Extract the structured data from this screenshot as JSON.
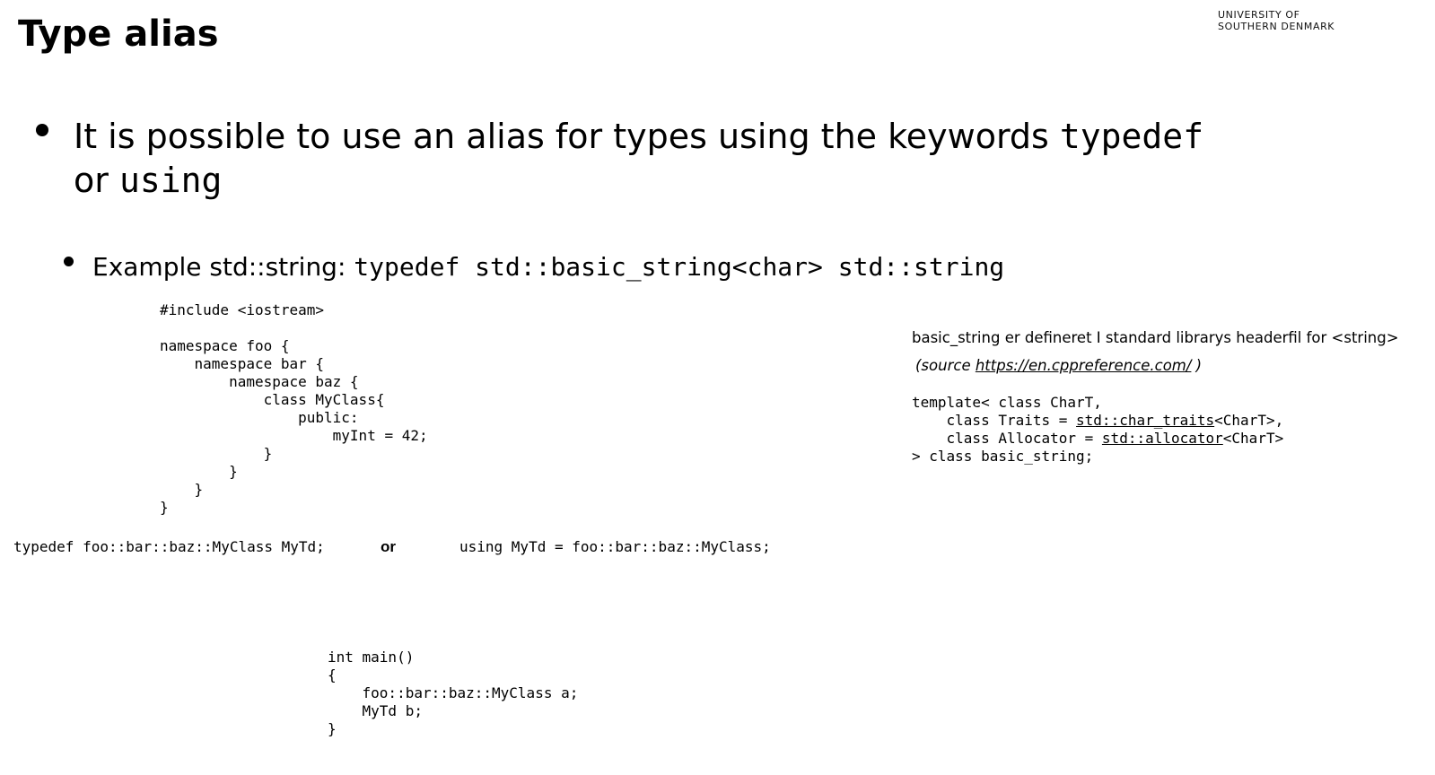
{
  "header": {
    "title": "Type alias",
    "logo_line1": "UNIVERSITY OF",
    "logo_line2": "SOUTHERN DENMARK"
  },
  "bullet1": {
    "text": "It is possible to use an alias for types using the keywords ",
    "kw_typedef": "typedef",
    "or_text": "or ",
    "kw_using": "using"
  },
  "bullet2": {
    "label": "Example std::string: ",
    "code": "typedef std::basic_string<char> std::string"
  },
  "namespace_code": "#include <iostream>\n\nnamespace foo {\n    namespace bar {\n        namespace baz {\n            class MyClass{\n                public:\n                    myInt = 42;\n            }\n        }\n    }\n}",
  "alias_line": {
    "typedef_code": "typedef foo::bar::baz::MyClass MyTd;",
    "or_label": "or",
    "using_code": "using MyTd = foo::bar::baz::MyClass;"
  },
  "main_code": "int main()\n{\n    foo::bar::baz::MyClass a;\n    MyTd b;\n}",
  "side_note": {
    "text": "basic_string er defineret I standard librarys headerfil for <string>",
    "source_prefix": "(source ",
    "source_link": "https://en.cppreference.com/",
    "source_suffix": " )",
    "template_line1": "template< class CharT,",
    "template_line2_prefix": "    class Traits = ",
    "template_line2_link": "std::char_traits",
    "template_line2_suffix": "<CharT>,",
    "template_line3_prefix": "    class Allocator = ",
    "template_line3_link": "std::allocator",
    "template_line3_suffix": "<CharT>",
    "template_line4": "> class basic_string;"
  }
}
